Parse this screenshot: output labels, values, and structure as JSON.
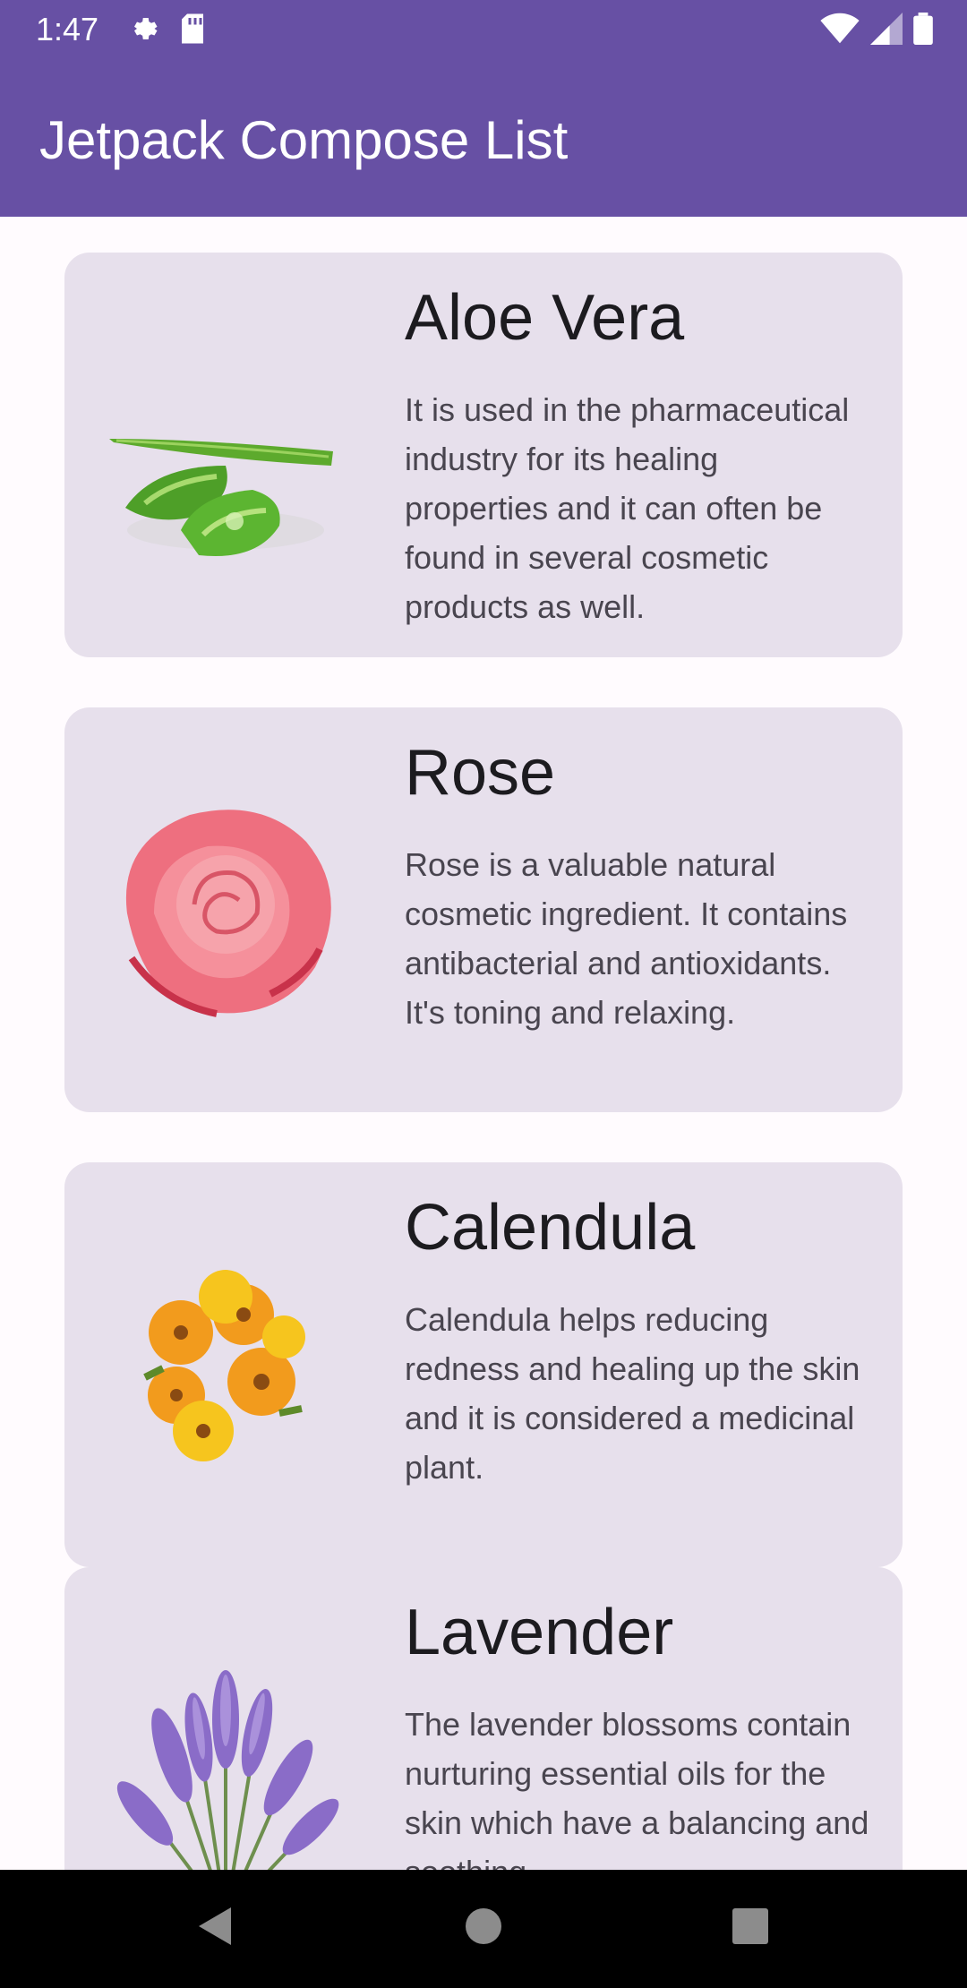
{
  "status_bar": {
    "time": "1:47"
  },
  "app_bar": {
    "title": "Jetpack Compose List"
  },
  "items": [
    {
      "title": "Aloe Vera",
      "description": "It is used in the pharmaceutical industry for its healing properties and it can often be found in several cosmetic products as well."
    },
    {
      "title": "Rose",
      "description": "Rose is a valuable natural cosmetic ingredient. It contains antibacterial and antioxidants. It's toning and relaxing."
    },
    {
      "title": "Calendula",
      "description": "Calendula helps reducing redness and healing up the skin and it is considered a medicinal plant."
    },
    {
      "title": "Lavender",
      "description": "The lavender blossoms contain nurturing essential oils for the skin which have a balancing and soothing"
    }
  ],
  "colors": {
    "primary": "#6750A4",
    "card": "#E7E0EC",
    "background": "#FFFBFE"
  }
}
